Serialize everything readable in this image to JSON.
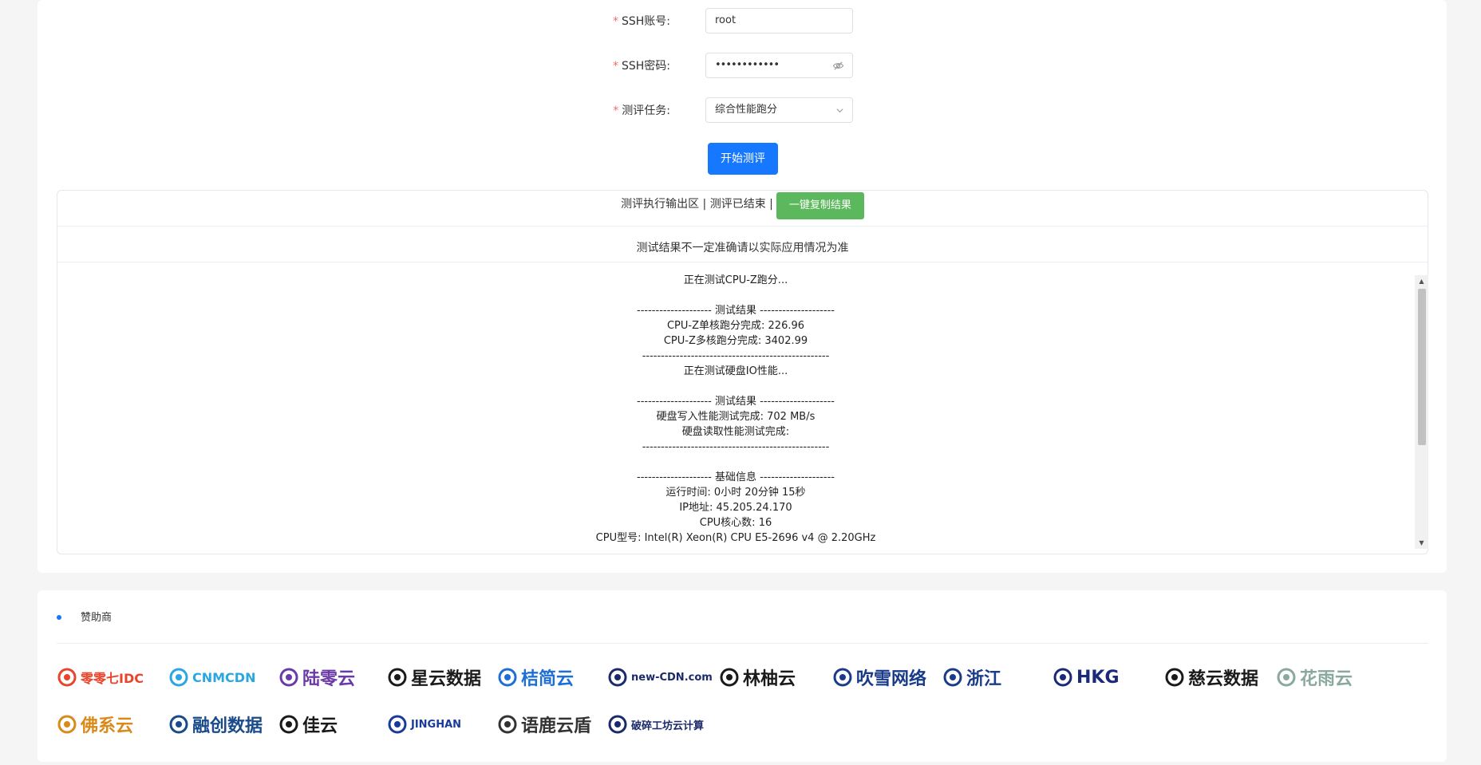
{
  "form": {
    "ssh_user_label": "SSH账号:",
    "ssh_user_value": "root",
    "ssh_pass_label": "SSH密码:",
    "ssh_pass_value": "••••••••••••",
    "task_label": "测评任务:",
    "task_value": "综合性能跑分",
    "required_mark": "*",
    "start_button": "开始测评"
  },
  "output": {
    "header_text": "测评执行输出区 | 测评已结束 |",
    "copy_button": "一键复制结果",
    "notice": "测试结果不一定准确请以实际应用情况为准",
    "lines": [
      "正在测试CPU-Z跑分...",
      "",
      "-------------------- 测试结果 --------------------",
      "CPU-Z单核跑分完成: 226.96",
      "CPU-Z多核跑分完成: 3402.99",
      "--------------------------------------------------",
      "正在测试硬盘IO性能...",
      "",
      "-------------------- 测试结果 --------------------",
      "硬盘写入性能测试完成: 702 MB/s",
      "硬盘读取性能测试完成:",
      "--------------------------------------------------",
      "",
      "-------------------- 基础信息 --------------------",
      "运行时间: 0小时 20分钟 15秒",
      "IP地址: 45.205.24.170",
      "CPU核心数: 16",
      "CPU型号: Intel(R) Xeon(R) CPU E5-2696 v4 @ 2.20GHz"
    ]
  },
  "sponsors": {
    "title": "赞助商",
    "logos": [
      {
        "text": "零零七IDC",
        "color": "#e8452c",
        "icon": "ring-logo-icon"
      },
      {
        "text": "CNMCDN",
        "color": "#2aa7e0",
        "icon": "shield-logo-icon"
      },
      {
        "text": "陆零云",
        "color": "#6a3aa8",
        "icon": "wave-logo-icon"
      },
      {
        "text": "星云数据",
        "color": "#1a1a1a",
        "icon": "cross-logo-icon"
      },
      {
        "text": "桔简云",
        "color": "#1d6fd6",
        "icon": "cloud-logo-icon"
      },
      {
        "text": "new-CDN.com",
        "color": "#1a2a6a",
        "icon": "cdn-logo-icon"
      },
      {
        "text": "林柚云",
        "color": "#1a1a1a",
        "icon": "circle-logo-icon"
      },
      {
        "text": "吹雪网络",
        "color": "#1a3a8a",
        "icon": "globe-logo-icon"
      },
      {
        "text": "浙江",
        "color": "#1a3a8a",
        "icon": "swirl-logo-icon"
      },
      {
        "text": "HKG",
        "color": "#1a2a7a",
        "icon": "slash-logo-icon"
      },
      {
        "text": "慈云数据",
        "color": "#1a1a1a",
        "icon": "wing-logo-icon"
      },
      {
        "text": "花雨云",
        "color": "#8aa8a0",
        "icon": "flower-logo-icon"
      },
      {
        "text": "佛系云",
        "color": "#d98a1a",
        "icon": "earth-logo-icon"
      },
      {
        "text": "融创数据",
        "color": "#1a4a8a",
        "icon": "cloud2-logo-icon"
      },
      {
        "text": "佳云",
        "color": "#1a1a1a",
        "icon": "swoosh-logo-icon"
      },
      {
        "text": "JINGHAN",
        "color": "#1a3a9a",
        "icon": "jh-logo-icon"
      },
      {
        "text": "语鹿云盾",
        "color": "#333333",
        "icon": "badge-logo-icon"
      },
      {
        "text": "破碎工坊云计算",
        "color": "#1a2a6a",
        "icon": "hex-logo-icon"
      }
    ]
  }
}
